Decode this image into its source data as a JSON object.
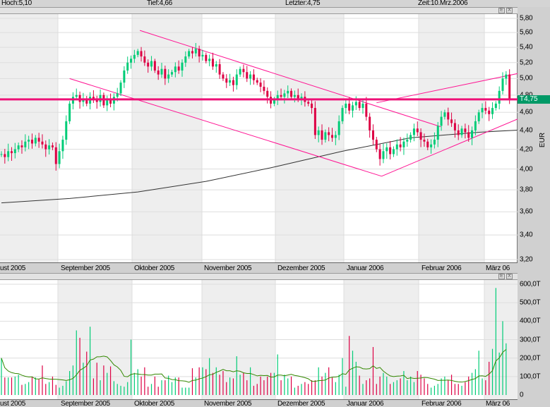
{
  "header": {
    "high": "Hoch:5,10",
    "low": "Tief:4,66",
    "last": "Letzter:4,75",
    "time": "Zeit:10.Mrz.2006"
  },
  "panel_buttons": {
    "e": "E",
    "x": "X"
  },
  "last_tag": "T4,75",
  "axis_unit": "EUR",
  "months": [
    "ust 2005",
    "September 2005",
    "Oktober 2005",
    "November 2005",
    "Dezember 2005",
    "Januar 2006",
    "Februar 2006",
    "März 06"
  ],
  "colors": {
    "up": "#00cc77",
    "down": "#dd0044",
    "trend": "#ff1493",
    "hline": "#ee1177",
    "ma": "#333333",
    "vol_ma": "#338800",
    "tag": "#009966"
  },
  "chart_data": [
    {
      "type": "candlestick",
      "title": "",
      "ylabel": "EUR",
      "scale": "log",
      "ylim": [
        3.2,
        5.8
      ],
      "yticks": [
        "5,80",
        "5,60",
        "5,40",
        "5,20",
        "5,00",
        "4,80",
        "4,60",
        "4,40",
        "4,20",
        "4,00",
        "3,80",
        "3,60",
        "3,40",
        "3,20"
      ],
      "ytick_values": [
        5.8,
        5.6,
        5.4,
        5.2,
        5.0,
        4.8,
        4.6,
        4.4,
        4.2,
        4.0,
        3.8,
        3.6,
        3.4,
        3.2
      ],
      "close": [
        4.15,
        4.12,
        4.18,
        4.16,
        4.2,
        4.24,
        4.22,
        4.28,
        4.3,
        4.26,
        4.32,
        4.28,
        4.25,
        4.2,
        4.24,
        4.22,
        4.05,
        4.18,
        4.3,
        4.5,
        4.7,
        4.78,
        4.8,
        4.72,
        4.76,
        4.7,
        4.78,
        4.75,
        4.72,
        4.8,
        4.68,
        4.74,
        4.7,
        4.78,
        4.82,
        4.95,
        5.1,
        5.2,
        5.25,
        5.3,
        5.35,
        5.28,
        5.2,
        5.15,
        5.22,
        5.1,
        5.05,
        5.12,
        5.0,
        5.05,
        5.08,
        5.15,
        5.1,
        5.2,
        5.28,
        5.35,
        5.32,
        5.38,
        5.28,
        5.3,
        5.22,
        5.25,
        5.15,
        5.18,
        5.05,
        5.0,
        4.95,
        4.98,
        4.92,
        5.05,
        5.12,
        5.08,
        5.0,
        5.05,
        4.98,
        4.95,
        4.9,
        4.85,
        4.78,
        4.7,
        4.75,
        4.8,
        4.78,
        4.82,
        4.85,
        4.78,
        4.8,
        4.76,
        4.78,
        4.72,
        4.7,
        4.65,
        4.35,
        4.4,
        4.3,
        4.38,
        4.35,
        4.32,
        4.35,
        4.5,
        4.65,
        4.7,
        4.62,
        4.68,
        4.72,
        4.65,
        4.7,
        4.55,
        4.4,
        4.3,
        4.2,
        4.1,
        4.18,
        4.22,
        4.15,
        4.2,
        4.25,
        4.22,
        4.28,
        4.3,
        4.35,
        4.42,
        4.38,
        4.3,
        4.28,
        4.22,
        4.25,
        4.3,
        4.45,
        4.55,
        4.6,
        4.52,
        4.48,
        4.4,
        4.35,
        4.42,
        4.38,
        4.32,
        4.4,
        4.5,
        4.6,
        4.65,
        4.62,
        4.58,
        4.65,
        4.7,
        4.85,
        5.0,
        5.05,
        4.75
      ],
      "moving_average": [
        [
          0,
          3.68
        ],
        [
          20,
          3.72
        ],
        [
          40,
          3.78
        ],
        [
          60,
          3.88
        ],
        [
          80,
          4.02
        ],
        [
          100,
          4.18
        ],
        [
          120,
          4.32
        ],
        [
          140,
          4.38
        ],
        [
          160,
          4.42
        ],
        [
          180,
          4.44
        ],
        [
          200,
          4.47
        ],
        [
          230,
          4.5
        ]
      ],
      "horizontal_line": 4.75,
      "trendlines": [
        [
          [
            40.6,
            5.63
          ],
          [
            128.8,
            4.44
          ]
        ],
        [
          [
            20,
            5.0
          ],
          [
            111.5,
            3.93
          ]
        ],
        [
          [
            110,
            4.71
          ],
          [
            152.3,
            5.07
          ]
        ],
        [
          [
            111.5,
            3.93
          ],
          [
            152.3,
            4.54
          ]
        ]
      ]
    },
    {
      "type": "bar",
      "title": "Volume",
      "ylim": [
        0,
        600
      ],
      "yticks": [
        "600,0T",
        "500,0T",
        "400,0T",
        "300,0T",
        "200,0T",
        "100,0T",
        "0"
      ],
      "ytick_values": [
        600,
        500,
        400,
        300,
        200,
        100,
        0
      ],
      "volume": [
        200,
        95,
        95,
        95,
        100,
        110,
        55,
        60,
        70,
        100,
        95,
        85,
        160,
        60,
        70,
        100,
        55,
        40,
        50,
        75,
        130,
        160,
        350,
        310,
        175,
        235,
        370,
        90,
        175,
        80,
        160,
        120,
        155,
        75,
        60,
        50,
        45,
        70,
        300,
        120,
        140,
        100,
        150,
        45,
        60,
        100,
        45,
        80,
        80,
        105,
        70,
        95,
        95,
        40,
        40,
        40,
        145,
        95,
        150,
        150,
        140,
        200,
        120,
        150,
        110,
        130,
        70,
        95,
        90,
        210,
        110,
        120,
        80,
        150,
        50,
        60,
        100,
        80,
        100,
        120,
        120,
        220,
        80,
        110,
        90,
        100,
        40,
        50,
        60,
        70,
        60,
        80,
        80,
        150,
        100,
        120,
        150,
        95,
        70,
        110,
        200,
        45,
        320,
        240,
        180,
        105,
        60,
        80,
        90,
        260,
        60,
        100,
        120,
        100,
        60,
        70,
        80,
        90,
        130,
        80,
        100,
        70,
        130,
        110,
        90,
        60,
        40,
        50,
        60,
        90,
        100,
        80,
        110,
        60,
        60,
        50,
        70,
        100,
        120,
        140,
        240,
        90,
        80,
        180,
        250,
        580,
        230,
        400,
        280
      ]
    }
  ]
}
